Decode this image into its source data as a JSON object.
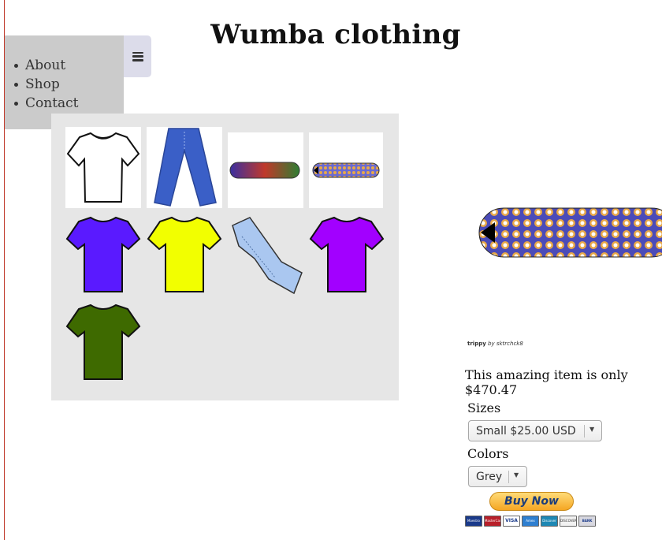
{
  "header": {
    "title": "Wumba clothing"
  },
  "nav": {
    "items": [
      {
        "label": "About"
      },
      {
        "label": "Shop"
      },
      {
        "label": "Contact"
      }
    ]
  },
  "gallery": {
    "items": [
      {
        "name": "white-tshirt",
        "color": "#ffffff"
      },
      {
        "name": "blue-jeans",
        "color": "#3a5fc7"
      },
      {
        "name": "multicolor-skateboard",
        "color": "#8a4a2a"
      },
      {
        "name": "trippy-skateboard",
        "color": "#7a62a8"
      },
      {
        "name": "blue-tshirt",
        "color": "#5a1aff"
      },
      {
        "name": "yellow-tshirt",
        "color": "#f2ff00"
      },
      {
        "name": "light-jeans",
        "color": "#aac7f0"
      },
      {
        "name": "purple-tshirt",
        "color": "#a200ff"
      },
      {
        "name": "green-tshirt",
        "color": "#3e6a00"
      }
    ]
  },
  "product": {
    "caption_title": "trippy",
    "caption_by": "by sktrchck8",
    "price_text": "This amazing item is only $470.47",
    "sizes_label": "Sizes",
    "size_selected": "Small $25.00 USD",
    "colors_label": "Colors",
    "color_selected": "Grey",
    "buy_label": "Buy Now"
  },
  "payment_cards": [
    {
      "label": "Maestro",
      "color": "#1a3a8a"
    },
    {
      "label": "MasterCard",
      "color": "#b8202a"
    },
    {
      "label": "VISA",
      "color": "#ffffff"
    },
    {
      "label": "Amex",
      "color": "#2e7fd0"
    },
    {
      "label": "Discover",
      "color": "#1e88b4"
    },
    {
      "label": "DISCOVER",
      "color": "#f2f2f2"
    },
    {
      "label": "BANK",
      "color": "#d8d8e0"
    }
  ],
  "colors": {
    "nav_bg": "#cbcbcb",
    "toggle_bg": "#dcdcea",
    "gallery_bg": "#e6e6e6",
    "left_rule": "#c0392b"
  }
}
